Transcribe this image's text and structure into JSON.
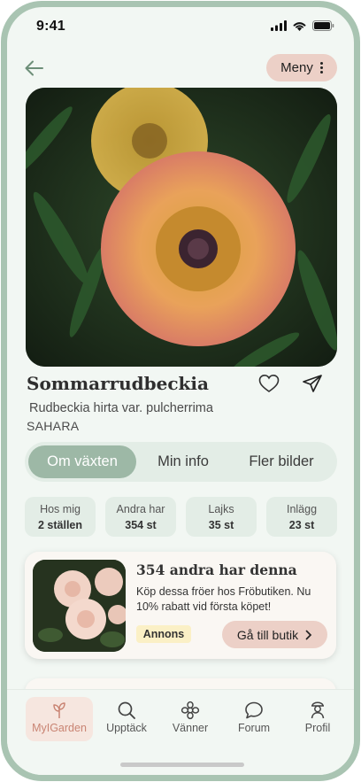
{
  "status_bar": {
    "time": "9:41"
  },
  "topbar": {
    "menu_label": "Meny"
  },
  "plant": {
    "name": "Sommarrudbeckia",
    "latin": "Rudbeckia hirta var. pulcherrima",
    "cultivar": "SAHARA"
  },
  "tabs": [
    {
      "label": "Om växten",
      "active": true
    },
    {
      "label": "Min info",
      "active": false
    },
    {
      "label": "Fler bilder",
      "active": false
    }
  ],
  "stats": [
    {
      "label": "Hos mig",
      "value": "2 ställen"
    },
    {
      "label": "Andra har",
      "value": "354 st"
    },
    {
      "label": "Lajks",
      "value": "35 st"
    },
    {
      "label": "Inlägg",
      "value": "23 st"
    }
  ],
  "ad": {
    "title": "354 andra har denna",
    "description": "Köp dessa fröer hos Fröbutiken. Nu 10% rabatt vid första köpet!",
    "badge": "Annons",
    "button_label": "Gå till butik"
  },
  "bottom_nav": [
    {
      "label": "MyIGarden",
      "icon": "sprout-icon",
      "active": true
    },
    {
      "label": "Upptäck",
      "icon": "search-icon",
      "active": false
    },
    {
      "label": "Vänner",
      "icon": "flower-icon",
      "active": false
    },
    {
      "label": "Forum",
      "icon": "chat-bubble-icon",
      "active": false
    },
    {
      "label": "Profil",
      "icon": "profile-icon",
      "active": false
    }
  ],
  "colors": {
    "frame": "#a9c4b2",
    "background": "#f2f7f3",
    "accent_green": "#9db8a6",
    "accent_pink": "#ecd0c7",
    "active_nav": "#c98473"
  }
}
